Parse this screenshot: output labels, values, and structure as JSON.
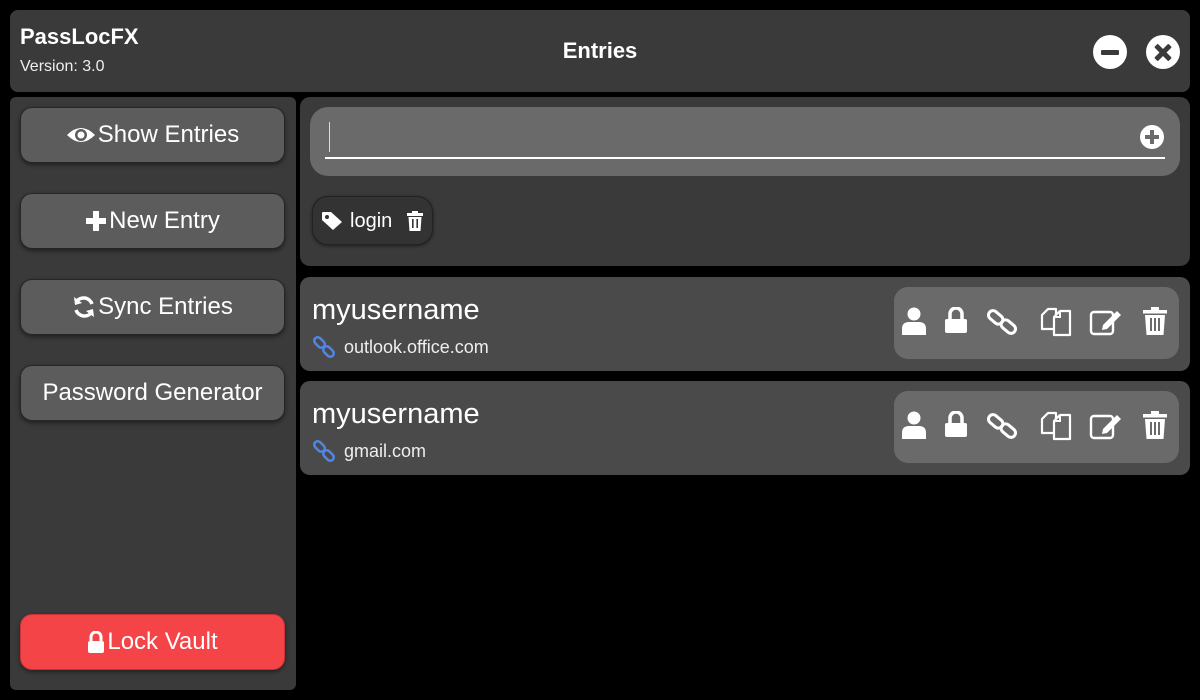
{
  "app": {
    "name": "PassLocFX",
    "version": "Version: 3.0",
    "page_title": "Entries"
  },
  "window_controls": {
    "minimize_icon": "minus-circle-icon",
    "close_icon": "x-circle-icon"
  },
  "sidebar": {
    "items": [
      {
        "label": "Show Entries",
        "icon": "eye-icon"
      },
      {
        "label": "New Entry",
        "icon": "plus-icon"
      },
      {
        "label": "Sync Entries",
        "icon": "refresh-icon"
      },
      {
        "label": "Password Generator"
      }
    ],
    "lock_button": {
      "label": "Lock Vault",
      "icon": "lock-icon",
      "color": "#f44448"
    }
  },
  "search": {
    "value": "",
    "placeholder": "",
    "add_icon": "plus-circle-icon"
  },
  "tags": [
    {
      "label": "login",
      "icon": "tag-icon",
      "delete_icon": "trash-icon"
    }
  ],
  "entries": [
    {
      "username": "myusername",
      "site": "outlook.office.com"
    },
    {
      "username": "myusername",
      "site": "gmail.com"
    }
  ],
  "entry_actions": [
    "user-icon",
    "lock-icon",
    "link-icon",
    "copy-icon",
    "edit-icon",
    "trash-icon"
  ],
  "colors": {
    "background": "#000000",
    "panel": "#3a3a3a",
    "button": "#5c5c5c",
    "accent_link": "#4f86e8",
    "danger": "#f44448"
  }
}
